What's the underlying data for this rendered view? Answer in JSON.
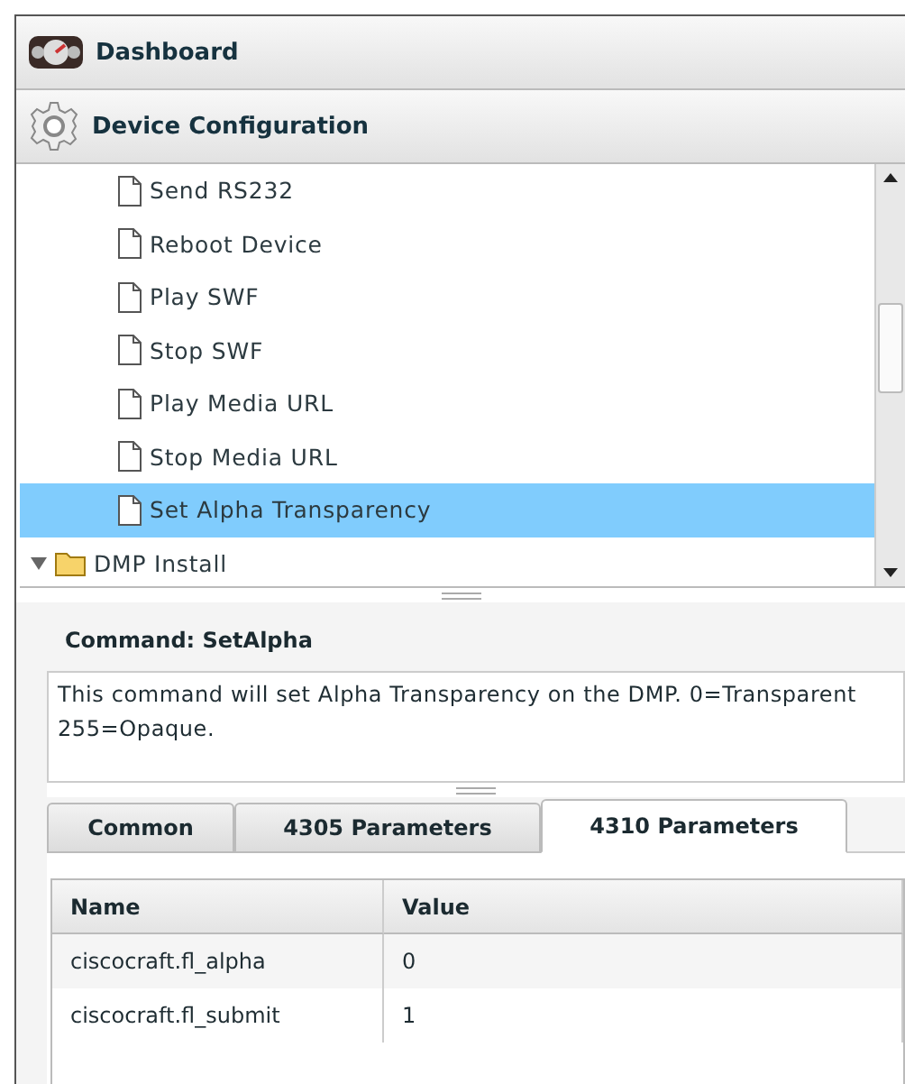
{
  "panels": [
    {
      "kind": "dashboard",
      "title": "Dashboard"
    },
    {
      "kind": "gear",
      "title": "Device Configuration"
    }
  ],
  "tree": {
    "items": [
      {
        "children": [
          {
            "kind": "file",
            "label": "Send RS232",
            "selected": false
          },
          {
            "kind": "file",
            "label": "Reboot Device",
            "selected": false
          },
          {
            "kind": "file",
            "label": "Play SWF",
            "selected": false
          },
          {
            "kind": "file",
            "label": "Stop SWF",
            "selected": false
          },
          {
            "kind": "file",
            "label": "Play Media URL",
            "selected": false
          },
          {
            "kind": "file",
            "label": "Stop Media URL",
            "selected": false
          },
          {
            "kind": "file",
            "label": "Set Alpha Transparency",
            "selected": true
          }
        ]
      },
      {
        "kind": "folder",
        "label": "DMP Install",
        "expanded": true,
        "selected": false
      }
    ]
  },
  "command": {
    "title": "Command: SetAlpha",
    "description": "This command will set Alpha Transparency on the DMP. 0=Transparent 255=Opaque.",
    "tabs": [
      {
        "label": "Common",
        "selected": false
      },
      {
        "label": "4305 Parameters",
        "selected": false
      },
      {
        "label": "4310 Parameters",
        "selected": true
      }
    ],
    "table": {
      "columns": [
        "Name",
        "Value"
      ],
      "rows": [
        [
          "ciscocraft.fl_alpha",
          "0"
        ],
        [
          "ciscocraft.fl_submit",
          "1"
        ]
      ]
    }
  }
}
